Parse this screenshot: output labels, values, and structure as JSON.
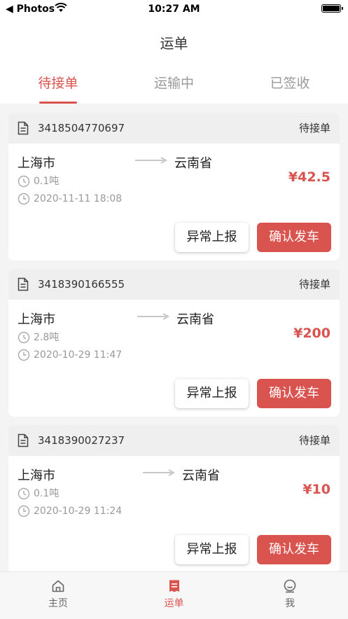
{
  "status_bar": {
    "back_label": "◀ Photos",
    "time": "10:27 AM"
  },
  "nav": {
    "title": "运单"
  },
  "tabs": [
    {
      "label": "待接单",
      "active": true
    },
    {
      "label": "运输中",
      "active": false
    },
    {
      "label": "已签收",
      "active": false
    }
  ],
  "orders": [
    {
      "number": "3418504770697",
      "status": "待接单",
      "from": "上海市",
      "to": "云南省",
      "weight": "0.1吨",
      "datetime": "2020-11-11 18:08",
      "price": "¥42.5"
    },
    {
      "number": "3418390166555",
      "status": "待接单",
      "from": "上海市",
      "to": "云南省",
      "weight": "2.8吨",
      "datetime": "2020-10-29 11:47",
      "price": "¥200"
    },
    {
      "number": "3418390027237",
      "status": "待接单",
      "from": "上海市",
      "to": "云南省",
      "weight": "0.1吨",
      "datetime": "2020-10-29 11:24",
      "price": "¥10"
    }
  ],
  "actions": {
    "report_label": "异常上报",
    "confirm_label": "确认发车"
  },
  "tabbar": [
    {
      "label": "主页",
      "icon": "home-icon"
    },
    {
      "label": "运单",
      "icon": "waybill-icon",
      "active": true
    },
    {
      "label": "我",
      "icon": "profile-icon"
    }
  ],
  "colors": {
    "accent": "#d9534f",
    "muted": "#999999",
    "header_bg": "#efefef"
  }
}
